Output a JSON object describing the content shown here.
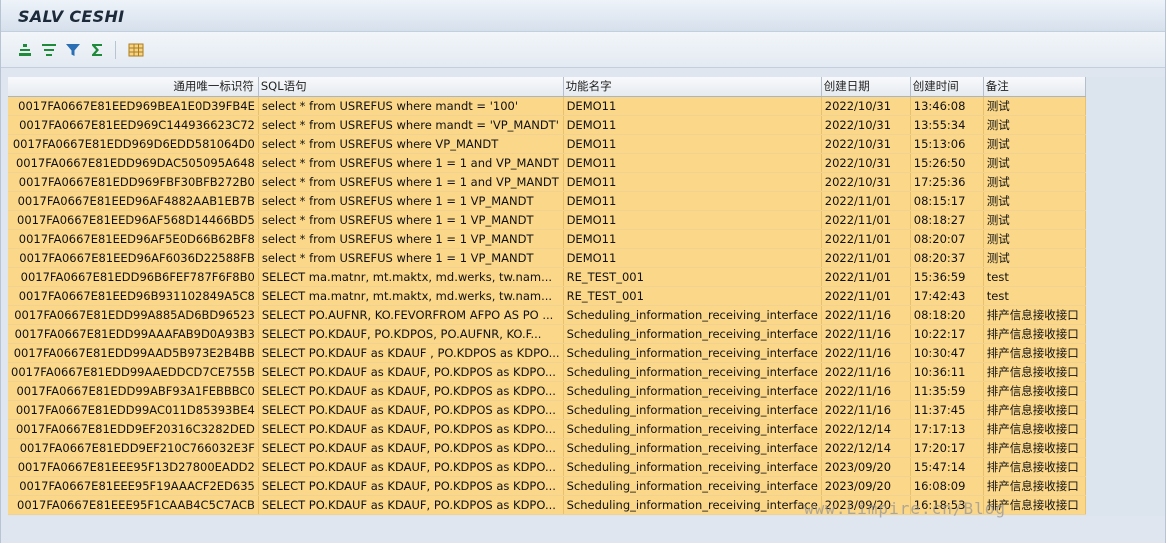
{
  "window": {
    "title": "SALV CESHI"
  },
  "toolbar": {
    "buttons": [
      {
        "icon": "align-center-icon",
        "color": "#1f8a3a"
      },
      {
        "icon": "filter-list-icon",
        "color": "#1f8a3a"
      },
      {
        "icon": "filter-icon",
        "color": "#2a6fb3"
      },
      {
        "icon": "sum-icon",
        "color": "#1f8a3a"
      },
      {
        "icon": "layout-grid-icon",
        "color": "#c08a1c"
      }
    ]
  },
  "table": {
    "columns": [
      "通用唯一标识符",
      "SQL语句",
      "功能名字",
      "创建日期",
      "创建时间",
      "备注"
    ],
    "rows": [
      [
        "0017FA0667E81EED969BEA1E0D39FB4E",
        "select * from USREFUS where mandt = '100'",
        "DEMO11",
        "2022/10/31",
        "13:46:08",
        "测试"
      ],
      [
        "0017FA0667E81EED969C144936623C72",
        "select * from USREFUS where mandt = 'VP_MANDT'",
        "DEMO11",
        "2022/10/31",
        "13:55:34",
        "测试"
      ],
      [
        "0017FA0667E81EDD969D6EDD581064D0",
        "select * from USREFUS where VP_MANDT",
        "DEMO11",
        "2022/10/31",
        "15:13:06",
        "测试"
      ],
      [
        "0017FA0667E81EDD969DAC505095A648",
        "select * from USREFUS where 1 = 1 and VP_MANDT",
        "DEMO11",
        "2022/10/31",
        "15:26:50",
        "测试"
      ],
      [
        "0017FA0667E81EDD969FBF30BFB272B0",
        "select * from USREFUS where 1 = 1 and VP_MANDT",
        "DEMO11",
        "2022/10/31",
        "17:25:36",
        "测试"
      ],
      [
        "0017FA0667E81EED96AF4882AAB1EB7B",
        "select * from USREFUS where 1 = 1 VP_MANDT",
        "DEMO11",
        "2022/11/01",
        "08:15:17",
        "测试"
      ],
      [
        "0017FA0667E81EED96AF568D14466BD5",
        "select * from USREFUS where 1 = 1 VP_MANDT",
        "DEMO11",
        "2022/11/01",
        "08:18:27",
        "测试"
      ],
      [
        "0017FA0667E81EED96AF5E0D66B62BF8",
        "select * from USREFUS where 1 = 1 VP_MANDT",
        "DEMO11",
        "2022/11/01",
        "08:20:07",
        "测试"
      ],
      [
        "0017FA0667E81EED96AF6036D22588FB",
        "select * from USREFUS where 1 = 1 VP_MANDT",
        "DEMO11",
        "2022/11/01",
        "08:20:37",
        "测试"
      ],
      [
        "0017FA0667E81EDD96B6FEF787F6F8B0",
        "SELECT  ma.matnr,  mt.maktx,  md.werks,  tw.nam...",
        "RE_TEST_001",
        "2022/11/01",
        "15:36:59",
        "test"
      ],
      [
        "0017FA0667E81EED96B931102849A5C8",
        "SELECT  ma.matnr,  mt.maktx,  md.werks,  tw.nam...",
        "RE_TEST_001",
        "2022/11/01",
        "17:42:43",
        "test"
      ],
      [
        "0017FA0667E81EDD99A885AD6BD96523",
        "SELECT  PO.AUFNR,  KO.FEVORFROM  AFPO AS PO ...",
        "Scheduling_information_receiving_interface",
        "2022/11/16",
        "08:18:20",
        "排产信息接收接口"
      ],
      [
        "0017FA0667E81EDD99AAAFAB9D0A93B3",
        "SELECT  PO.KDAUF,  PO.KDPOS,  PO.AUFNR,  KO.F...",
        "Scheduling_information_receiving_interface",
        "2022/11/16",
        "10:22:17",
        "排产信息接收接口"
      ],
      [
        "0017FA0667E81EDD99AAD5B973E2B4BB",
        "SELECT  PO.KDAUF as KDAUF ,  PO.KDPOS as KDPO...",
        "Scheduling_information_receiving_interface",
        "2022/11/16",
        "10:30:47",
        "排产信息接收接口"
      ],
      [
        "0017FA0667E81EDD99AAEDDCD7CE755B",
        "SELECT  PO.KDAUF as KDAUF,  PO.KDPOS as KDPO...",
        "Scheduling_information_receiving_interface",
        "2022/11/16",
        "10:36:11",
        "排产信息接收接口"
      ],
      [
        "0017FA0667E81EDD99ABF93A1FEBBBC0",
        "SELECT  PO.KDAUF as KDAUF,  PO.KDPOS as KDPO...",
        "Scheduling_information_receiving_interface",
        "2022/11/16",
        "11:35:59",
        "排产信息接收接口"
      ],
      [
        "0017FA0667E81EDD99AC011D85393BE4",
        "SELECT  PO.KDAUF as KDAUF,  PO.KDPOS as KDPO...",
        "Scheduling_information_receiving_interface",
        "2022/11/16",
        "11:37:45",
        "排产信息接收接口"
      ],
      [
        "0017FA0667E81EDD9EF20316C3282DED",
        "SELECT  PO.KDAUF as KDAUF,  PO.KDPOS as KDPO...",
        "Scheduling_information_receiving_interface",
        "2022/12/14",
        "17:17:13",
        "排产信息接收接口"
      ],
      [
        "0017FA0667E81EDD9EF210C766032E3F",
        "SELECT  PO.KDAUF as KDAUF,  PO.KDPOS as KDPO...",
        "Scheduling_information_receiving_interface",
        "2022/12/14",
        "17:20:17",
        "排产信息接收接口"
      ],
      [
        "0017FA0667E81EEE95F13D27800EADD2",
        "SELECT  PO.KDAUF as KDAUF,  PO.KDPOS as KDPO...",
        "Scheduling_information_receiving_interface",
        "2023/09/20",
        "15:47:14",
        "排产信息接收接口"
      ],
      [
        "0017FA0667E81EEE95F19AAACF2ED635",
        "SELECT  PO.KDAUF as KDAUF,  PO.KDPOS as KDPO...",
        "Scheduling_information_receiving_interface",
        "2023/09/20",
        "16:08:09",
        "排产信息接收接口"
      ],
      [
        "0017FA0667E81EEE95F1CAAB4C5C7ACB",
        "SELECT  PO.KDAUF as KDAUF,  PO.KDPOS as KDPO...",
        "Scheduling_information_receiving_interface",
        "2023/09/20",
        "16:18:53",
        "排产信息接收接口"
      ]
    ]
  },
  "watermark": {
    "text": "www.Limpire.cn/Blog"
  }
}
